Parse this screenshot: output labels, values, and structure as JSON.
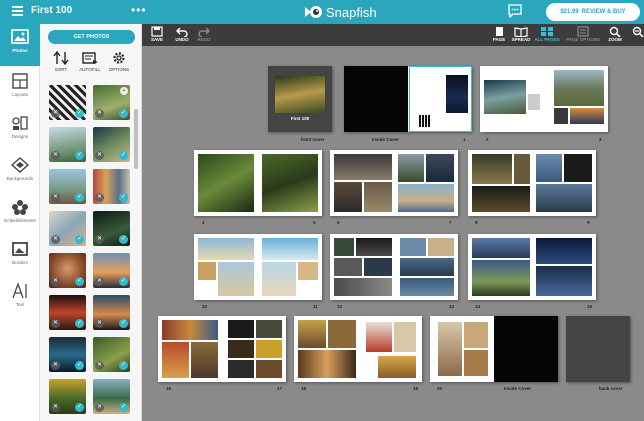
{
  "header": {
    "title": "First 100",
    "logo_text": "Snapfish",
    "buy_price": "$21.99",
    "buy_label": "REVIEW & BUY",
    "brand_color": "#2aa7bd"
  },
  "rail": [
    {
      "label": "Photos",
      "icon": "photos-icon",
      "active": true
    },
    {
      "label": "Layouts",
      "icon": "layouts-icon"
    },
    {
      "label": "Designs",
      "icon": "designs-icon"
    },
    {
      "label": "Backgrounds",
      "icon": "backgrounds-icon"
    },
    {
      "label": "Embellishments",
      "icon": "embellishments-icon"
    },
    {
      "label": "Borders",
      "icon": "borders-icon"
    },
    {
      "label": "Text",
      "icon": "text-icon"
    }
  ],
  "panel": {
    "get_photos": "GET PHOTOS",
    "tools": [
      "SORT",
      "AUTOFILL",
      "OPTIONS"
    ]
  },
  "toolbar": {
    "save": "SAVE",
    "undo": "UNDO",
    "redo": "REDO",
    "page": "PAGE",
    "spread": "SPREAD",
    "all_pages": "ALL PAGES",
    "page_options": "PAGE OPTIONS",
    "zoom": "ZOOM"
  },
  "pages": {
    "front_cover": "front cover",
    "inside_cover": "Inside Cover",
    "inside_cover_back": "Inside Cover",
    "back_cover": "back cover",
    "cover_title": "First 100",
    "numbers": [
      "1",
      "2",
      "3",
      "4",
      "5",
      "6",
      "7",
      "8",
      "9",
      "10",
      "11",
      "12",
      "13",
      "14",
      "15",
      "16",
      "17",
      "18",
      "19",
      "20"
    ]
  }
}
